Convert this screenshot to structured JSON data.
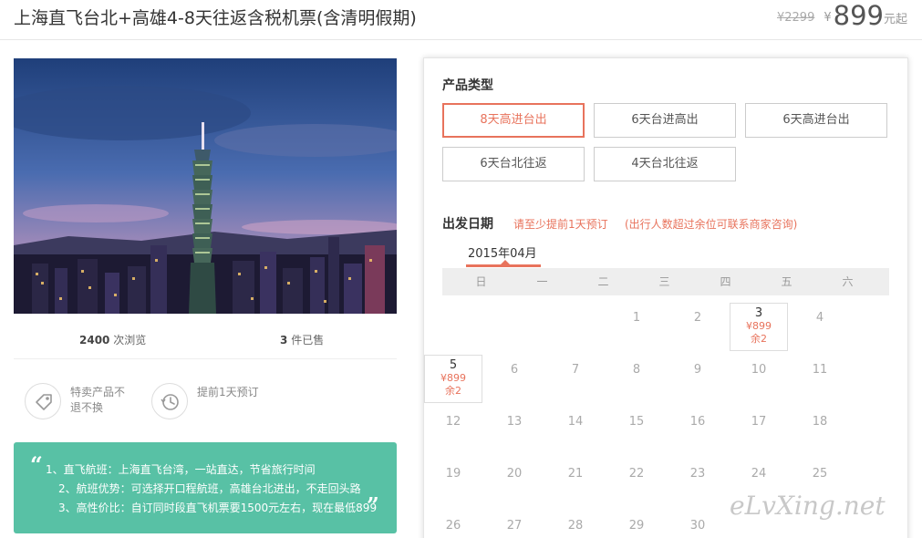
{
  "header": {
    "title": "上海直飞台北+高雄4-8天往返含税机票(含清明假期)",
    "orig_price": "¥2299",
    "currency": "¥",
    "price": "899",
    "price_suffix": "元起"
  },
  "stats": {
    "views_num": "2400",
    "views_label": "次浏览",
    "sold_num": "3",
    "sold_label": "件已售"
  },
  "promises": [
    {
      "icon": "tag-icon",
      "text": "特卖产品不退不换"
    },
    {
      "icon": "clock-icon",
      "text": "提前1天预订"
    }
  ],
  "highlights": {
    "open_quote": "“",
    "close_quote": "”",
    "items": [
      "1、直飞航班：上海直飞台湾，一站直达，节省旅行时间",
      "2、航班优势：可选择开口程航班，高雄台北进出，不走回头路",
      "3、高性价比：自订同时段直飞机票要1500元左右，现在最低899"
    ]
  },
  "product": {
    "label": "产品类型",
    "options": [
      "8天高进台出",
      "6天台进高出",
      "6天高进台出",
      "6天台北往返",
      "4天台北往返"
    ],
    "selected_index": 0
  },
  "departure": {
    "label": "出发日期",
    "notice1": "请至少提前1天预订",
    "notice2": "(出行人数超过余位可联系商家咨询)"
  },
  "calendar": {
    "month": "2015年04月",
    "weekdays": [
      "日",
      "一",
      "二",
      "三",
      "四",
      "五",
      "六"
    ],
    "days": [
      {
        "num": "1",
        "avail": false
      },
      {
        "num": "2",
        "avail": false
      },
      {
        "num": "3",
        "avail": true,
        "price": "¥899",
        "left": "余2"
      },
      {
        "num": "4",
        "avail": false
      },
      {
        "num": "5",
        "avail": true,
        "price": "¥899",
        "left": "余2"
      },
      {
        "num": "6",
        "avail": false
      },
      {
        "num": "7",
        "avail": false
      },
      {
        "num": "8",
        "avail": false
      },
      {
        "num": "9",
        "avail": false
      },
      {
        "num": "10",
        "avail": false
      },
      {
        "num": "11",
        "avail": false
      },
      {
        "num": "12",
        "avail": false
      },
      {
        "num": "13",
        "avail": false
      },
      {
        "num": "14",
        "avail": false
      },
      {
        "num": "15",
        "avail": false
      },
      {
        "num": "16",
        "avail": false
      },
      {
        "num": "17",
        "avail": false
      },
      {
        "num": "18",
        "avail": false
      },
      {
        "num": "19",
        "avail": false
      },
      {
        "num": "20",
        "avail": false
      },
      {
        "num": "21",
        "avail": false
      },
      {
        "num": "22",
        "avail": false
      },
      {
        "num": "23",
        "avail": false
      },
      {
        "num": "24",
        "avail": false
      },
      {
        "num": "25",
        "avail": false
      },
      {
        "num": "26",
        "avail": false
      },
      {
        "num": "27",
        "avail": false
      },
      {
        "num": "28",
        "avail": false
      },
      {
        "num": "29",
        "avail": false
      },
      {
        "num": "30",
        "avail": false
      }
    ]
  },
  "watermark": "eLvXing.net",
  "colors": {
    "accent": "#e8735c",
    "green": "#58c1a5"
  }
}
